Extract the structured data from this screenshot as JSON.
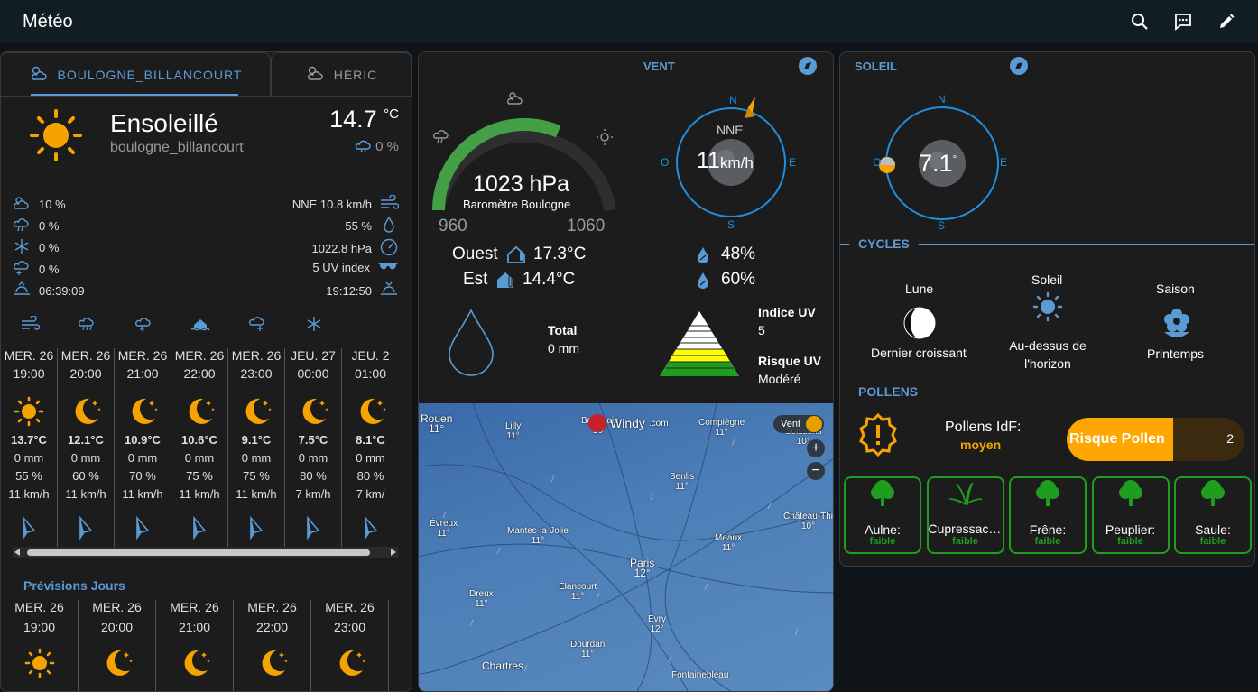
{
  "app": {
    "title": "Météo"
  },
  "tabs": [
    {
      "label": "BOULOGNE_BILLANCOURT"
    },
    {
      "label": "HÉRIC"
    }
  ],
  "current": {
    "condition": "Ensoleillé",
    "location": "boulogne_billancourt",
    "temp": "14.7",
    "unit": "°C",
    "precip": "0 %"
  },
  "attributes_left": [
    "10 %",
    "0 %",
    "0 %",
    "0 %",
    "06:39:09"
  ],
  "attributes_right": [
    "NNE 10.8 km/h",
    "55 %",
    "1022.8 hPa",
    "5 UV index",
    "19:12:50"
  ],
  "hourly": [
    {
      "day": "MER. 26",
      "time": "19:00",
      "icon": "sun-icon",
      "temp": "13.7°C",
      "rain": "0 mm",
      "hum": "55 %",
      "wind": "11 km/h"
    },
    {
      "day": "MER. 26",
      "time": "20:00",
      "icon": "moon-icon",
      "temp": "12.1°C",
      "rain": "0 mm",
      "hum": "60 %",
      "wind": "11 km/h"
    },
    {
      "day": "MER. 26",
      "time": "21:00",
      "icon": "moon-icon",
      "temp": "10.9°C",
      "rain": "0 mm",
      "hum": "70 %",
      "wind": "11 km/h"
    },
    {
      "day": "MER. 26",
      "time": "22:00",
      "icon": "moon-icon",
      "temp": "10.6°C",
      "rain": "0 mm",
      "hum": "75 %",
      "wind": "11 km/h"
    },
    {
      "day": "MER. 26",
      "time": "23:00",
      "icon": "moon-icon",
      "temp": "9.1°C",
      "rain": "0 mm",
      "hum": "75 %",
      "wind": "11 km/h"
    },
    {
      "day": "JEU. 27",
      "time": "00:00",
      "icon": "moon-icon",
      "temp": "7.5°C",
      "rain": "0 mm",
      "hum": "80 %",
      "wind": "7 km/h"
    },
    {
      "day": "JEU. 2",
      "time": "01:00",
      "icon": "moon-icon",
      "temp": "8.1°C",
      "rain": "0 mm",
      "hum": "80 %",
      "wind": "7 km/"
    }
  ],
  "daily_section": {
    "title": "Prévisions Jours"
  },
  "daily": [
    {
      "day": "MER. 26",
      "time": "19:00",
      "icon": "sun-icon"
    },
    {
      "day": "MER. 26",
      "time": "20:00",
      "icon": "moon-icon"
    },
    {
      "day": "MER. 26",
      "time": "21:00",
      "icon": "moon-icon"
    },
    {
      "day": "MER. 26",
      "time": "22:00",
      "icon": "moon-icon"
    },
    {
      "day": "MER. 26",
      "time": "23:00",
      "icon": "moon-icon"
    }
  ],
  "vent": {
    "title": "VENT",
    "pressure": "1023 hPa",
    "pressure_label": "Baromètre Boulogne",
    "gauge_min": "960",
    "gauge_max": "1060",
    "gauge_value": 1023,
    "ouest_label": "Ouest",
    "ouest_temp": "17.3°C",
    "est_label": "Est",
    "est_temp": "14.4°C",
    "hum1": "48%",
    "hum2": "60%",
    "compass": {
      "dir": "NNE",
      "speed": "11",
      "unit": "km/h",
      "n": "N",
      "s": "S",
      "e": "E",
      "o": "O"
    },
    "total_label": "Total",
    "total_value": "0 mm",
    "uv_label": "Indice UV",
    "uv_value": "5",
    "risk_label": "Risque UV",
    "risk_value": "Modéré"
  },
  "map": {
    "brand": "Windy",
    "brand_suffix": ".com",
    "layer": "Vent",
    "cities": [
      {
        "name": "Rouen",
        "t": "11°"
      },
      {
        "name": "Lilly",
        "t": "11°"
      },
      {
        "name": "Beauvais",
        "t": "10°"
      },
      {
        "name": "Compiègne",
        "t": "11°"
      },
      {
        "name": "Soissons",
        "t": "10°"
      },
      {
        "name": "Senlis",
        "t": "11°"
      },
      {
        "name": "Évreux",
        "t": "11°"
      },
      {
        "name": "Mantes-la-Jolie",
        "t": "11°"
      },
      {
        "name": "Château-Thi",
        "t": "10°"
      },
      {
        "name": "Meaux",
        "t": "11°"
      },
      {
        "name": "Paris",
        "t": "12°"
      },
      {
        "name": "Élancourt",
        "t": "11°"
      },
      {
        "name": "Dreux",
        "t": "11°"
      },
      {
        "name": "Évry",
        "t": "12°"
      },
      {
        "name": "Dourdan",
        "t": "11°"
      },
      {
        "name": "Chartres",
        "t": ""
      },
      {
        "name": "Fontainebleau",
        "t": ""
      }
    ]
  },
  "soleil": {
    "title": "SOLEIL",
    "elevation": "7.1",
    "deg": "°",
    "n": "N",
    "s": "S",
    "e": "E",
    "o": "O"
  },
  "cycles": {
    "title": "CYCLES",
    "items": [
      {
        "label": "Lune",
        "value": "Dernier croissant"
      },
      {
        "label": "Soleil",
        "value": "Au-dessus de l'horizon"
      },
      {
        "label": "Saison",
        "value": "Printemps"
      }
    ]
  },
  "pollens": {
    "title": "POLLENS",
    "idf_label": "Pollens IdF:",
    "idf_value": "moyen",
    "risk_label": "Risque Pollen",
    "risk_value": "2",
    "risk_fraction": 0.6,
    "items": [
      {
        "name": "Aulne:",
        "level": "faible",
        "icon": "tree-icon"
      },
      {
        "name": "Cupressacé…",
        "level": "faible",
        "icon": "grass-icon"
      },
      {
        "name": "Frêne:",
        "level": "faible",
        "icon": "tree-icon"
      },
      {
        "name": "Peuplier:",
        "level": "faible",
        "icon": "tree-icon"
      },
      {
        "name": "Saule:",
        "level": "faible",
        "icon": "tree-icon"
      }
    ]
  },
  "colors": {
    "accent": "#5b9bd5",
    "sun": "#f5a300",
    "green": "#1f9d1f",
    "compass": "#1e90e0"
  }
}
